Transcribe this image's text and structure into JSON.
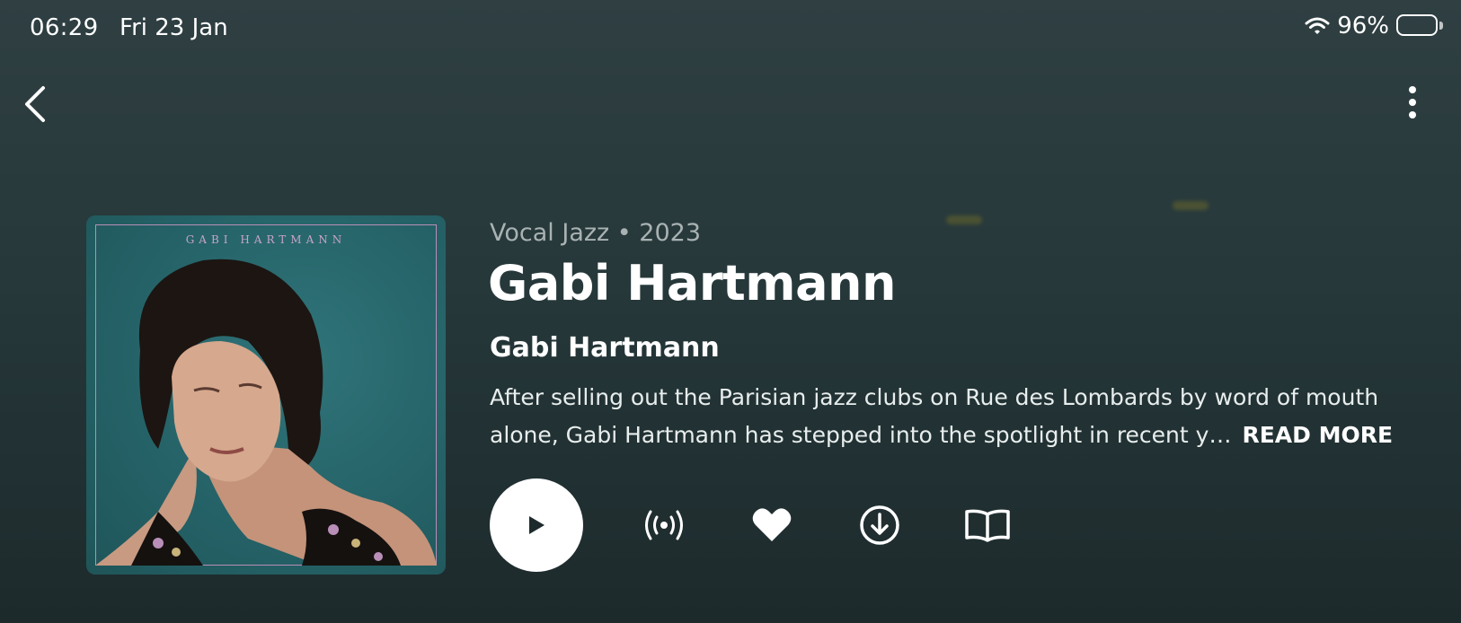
{
  "status_bar": {
    "time": "06:29",
    "date": "Fri 23 Jan",
    "battery": "96%",
    "icons": [
      "wifi-icon",
      "battery-icon"
    ]
  },
  "nav": {
    "back_icon": "chevron-left-icon",
    "more_icon": "vertical-ellipsis-icon"
  },
  "album": {
    "cover_text": "GABI HARTMANN",
    "genre_year": "Vocal Jazz • 2023",
    "title": "Gabi Hartmann",
    "artist": "Gabi Hartmann",
    "description_line1": "After selling out the Parisian jazz clubs on Rue des Lombards by word of mouth",
    "description_line2": "alone, Gabi Hartmann has stepped into the spotlight in recent y…",
    "read_more": "READ MORE"
  },
  "actions": {
    "play_icon": "play-icon",
    "radio_icon": "radio-broadcast-icon",
    "favorite_icon": "heart-icon",
    "download_icon": "download-icon",
    "booklet_icon": "open-book-icon"
  },
  "colors": {
    "background_top": "#2f3f42",
    "background_bottom": "#1d2a2c",
    "cover_teal": "#246166",
    "cover_frame": "#b98fb8",
    "secondary_text": "#a9b2b3"
  }
}
